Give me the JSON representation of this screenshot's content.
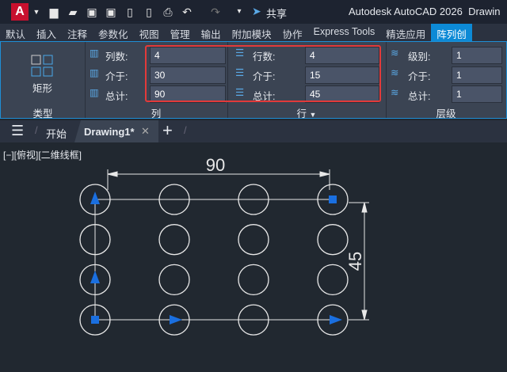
{
  "app": {
    "logo": "A",
    "title": "Autodesk AutoCAD 2026",
    "doc_title_partial": "Drawin",
    "share": "共享"
  },
  "quick_access": [
    "new-icon",
    "open-icon",
    "save-icon",
    "save-as-icon",
    "open-web-icon",
    "save-web-icon",
    "plot-icon",
    "undo-icon",
    "redo-icon",
    "customize-icon"
  ],
  "tabs": [
    "默认",
    "插入",
    "注释",
    "参数化",
    "视图",
    "管理",
    "输出",
    "附加模块",
    "协作",
    "Express Tools",
    "精选应用",
    "阵列创"
  ],
  "ribbon": {
    "type_panel": {
      "button": "矩形",
      "label": "类型"
    },
    "columns": {
      "label": "列",
      "count_label": "列数:",
      "count": "4",
      "between_label": "介于:",
      "between": "30",
      "total_label": "总计:",
      "total": "90"
    },
    "rows": {
      "label": "行",
      "count_label": "行数:",
      "count": "4",
      "between_label": "介于:",
      "between": "15",
      "total_label": "总计:",
      "total": "45"
    },
    "levels": {
      "label": "层级",
      "count_label": "级别:",
      "count": "1",
      "between_label": "介于:",
      "between": "1",
      "total_label": "总计:",
      "total": "1"
    }
  },
  "doc_tabs": {
    "start": "开始",
    "active": "Drawing1*"
  },
  "viewport": {
    "label": "[−][俯视][二维线框]",
    "dim_horizontal": "90",
    "dim_vertical": "45"
  },
  "colors": {
    "accent": "#0d8ad6",
    "highlight": "#e23a3a",
    "grip": "#1a6fe0"
  }
}
